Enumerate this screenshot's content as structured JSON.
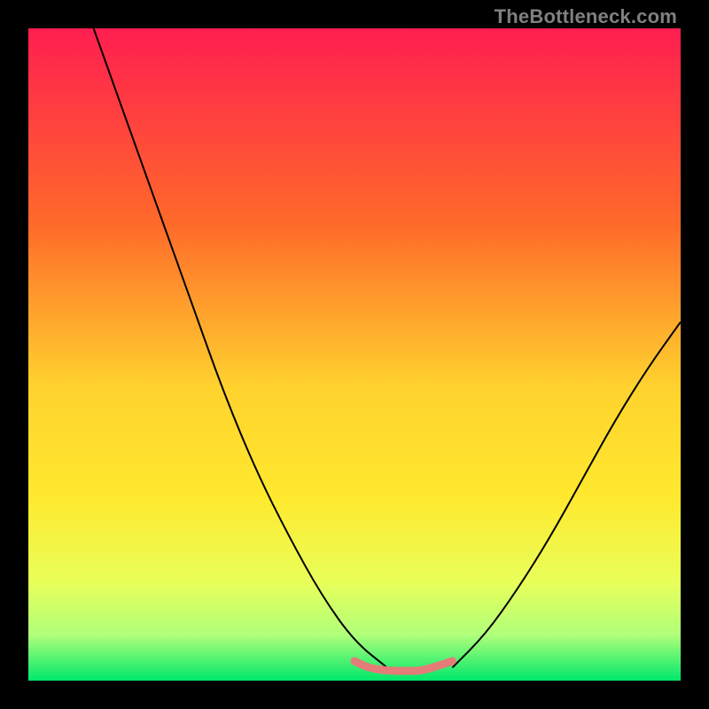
{
  "watermark": {
    "text": "TheBottleneck.com"
  },
  "colors": {
    "black": "#000000",
    "red_top": "#ff1e50",
    "orange": "#ff7a1e",
    "yellow": "#ffe92e",
    "yellow_green": "#e6ff4a",
    "pale_green": "#b6ff7a",
    "green": "#00e86b",
    "curve": "#000000",
    "zone": "#e47c78",
    "watermark": "#808080"
  },
  "chart_data": {
    "type": "line",
    "title": "",
    "xlabel": "",
    "ylabel": "",
    "xlim": [
      0,
      100
    ],
    "ylim": [
      0,
      100
    ],
    "grid": false,
    "series": [
      {
        "name": "bottleneck-curve-left",
        "x": [
          10,
          15,
          20,
          25,
          30,
          35,
          40,
          45,
          50,
          55
        ],
        "values": [
          100,
          86,
          72,
          58,
          44,
          32,
          22,
          13,
          6,
          2
        ]
      },
      {
        "name": "bottleneck-curve-right",
        "x": [
          65,
          70,
          75,
          80,
          85,
          90,
          95,
          100
        ],
        "values": [
          2,
          7,
          14,
          22,
          31,
          40,
          48,
          55
        ]
      },
      {
        "name": "zone-flat",
        "x": [
          50,
          52,
          55,
          58,
          60,
          62,
          65
        ],
        "values": [
          3,
          2,
          1.5,
          1.5,
          1.5,
          2,
          3
        ]
      }
    ],
    "gradient_stops": [
      {
        "pct": 0,
        "color": "#ff1e50"
      },
      {
        "pct": 30,
        "color": "#ff6a2a"
      },
      {
        "pct": 55,
        "color": "#ffd22e"
      },
      {
        "pct": 72,
        "color": "#ffe92e"
      },
      {
        "pct": 85,
        "color": "#e8ff5a"
      },
      {
        "pct": 93,
        "color": "#b0ff7a"
      },
      {
        "pct": 100,
        "color": "#00e86b"
      }
    ]
  }
}
